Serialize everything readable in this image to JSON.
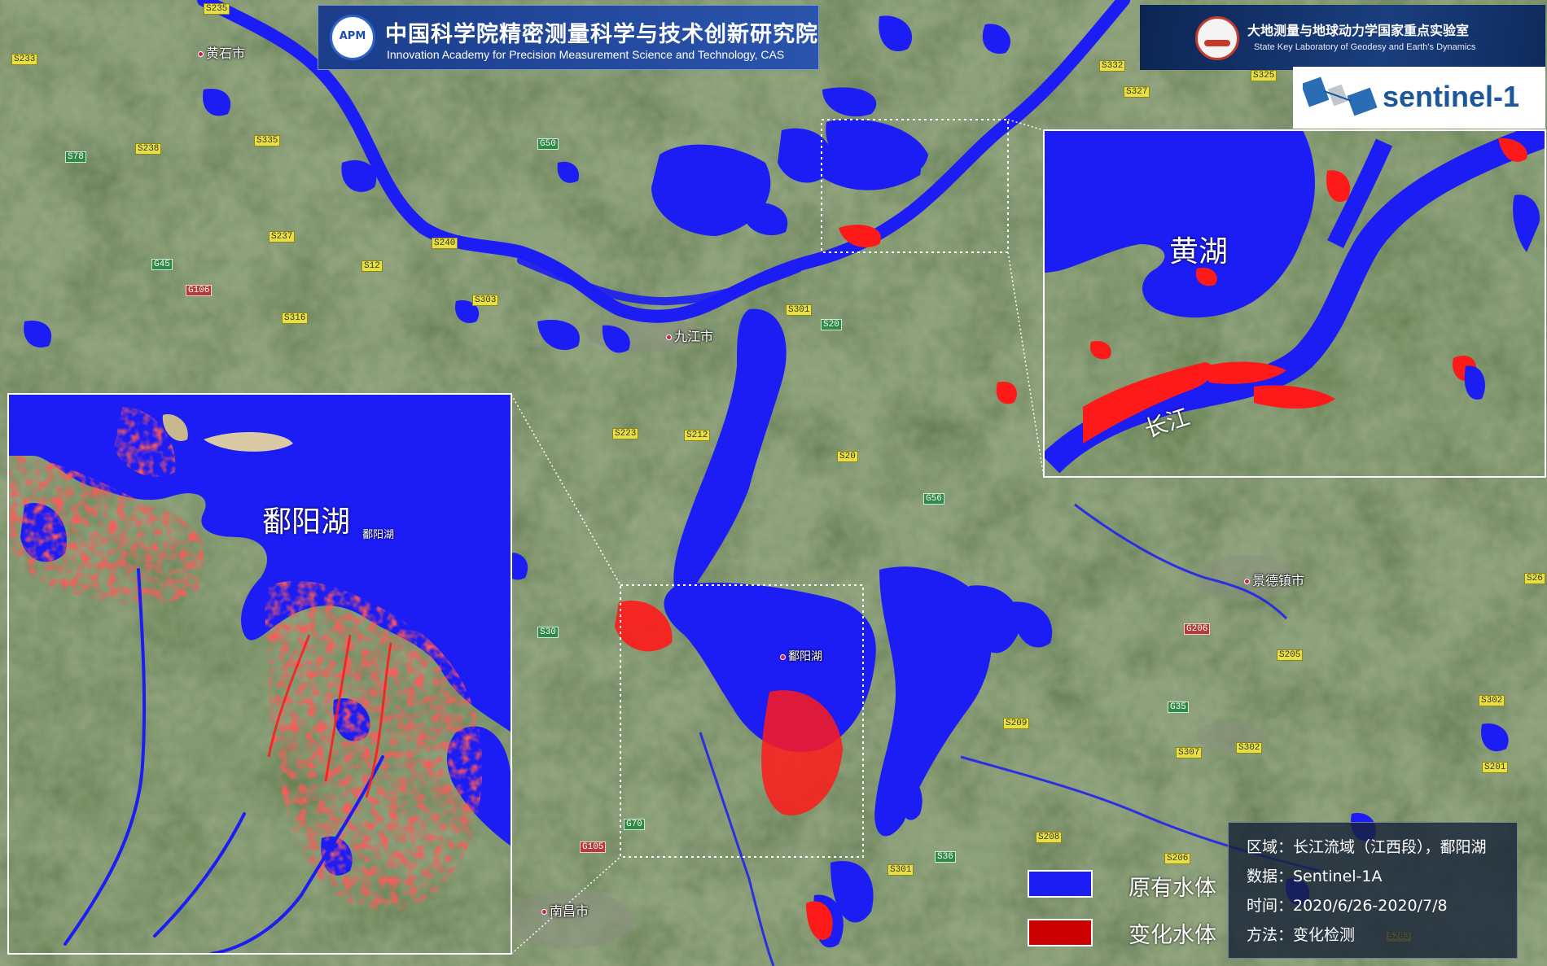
{
  "header_left": {
    "logo_text": "APM",
    "title_cn": "中国科学院精密测量科学与技术创新研究院",
    "title_en": "Innovation Academy for Precision Measurement Science and Technology, CAS"
  },
  "header_right": {
    "title_cn": "大地测量与地球动力学国家重点实验室",
    "title_en": "State Key Laboratory of Geodesy and Earth's Dynamics"
  },
  "sentinel_logo": "sentinel-1",
  "insets": {
    "poyang_label": "鄱阳湖",
    "poyang_small": "鄱阳湖",
    "huanghu_label": "黄湖",
    "changjiang_label": "长江"
  },
  "cities": [
    {
      "id": "huangshi",
      "name": "黄石市"
    },
    {
      "id": "jiujiang",
      "name": "九江市"
    },
    {
      "id": "jingdezhen",
      "name": "景德镇市"
    },
    {
      "id": "nanchang",
      "name": "南昌市"
    },
    {
      "id": "poyang-main",
      "name": "鄱阳湖"
    }
  ],
  "roads": [
    {
      "label": "S235",
      "type": "s"
    },
    {
      "label": "S233",
      "type": "s"
    },
    {
      "label": "S238",
      "type": "s"
    },
    {
      "label": "S78",
      "type": "g"
    },
    {
      "label": "S335",
      "type": "s"
    },
    {
      "label": "G50",
      "type": "g"
    },
    {
      "label": "S237",
      "type": "s"
    },
    {
      "label": "G45",
      "type": "g"
    },
    {
      "label": "G106",
      "type": "r"
    },
    {
      "label": "S240",
      "type": "s"
    },
    {
      "label": "S12",
      "type": "s"
    },
    {
      "label": "S303",
      "type": "s"
    },
    {
      "label": "S316",
      "type": "s"
    },
    {
      "label": "S332",
      "type": "s"
    },
    {
      "label": "S327",
      "type": "s"
    },
    {
      "label": "S325",
      "type": "s"
    },
    {
      "label": "S301",
      "type": "s"
    },
    {
      "label": "S20",
      "type": "g"
    },
    {
      "label": "S212",
      "type": "s"
    },
    {
      "label": "S223",
      "type": "s"
    },
    {
      "label": "S20",
      "type": "s"
    },
    {
      "label": "G56",
      "type": "g"
    },
    {
      "label": "S30",
      "type": "g"
    },
    {
      "label": "G206",
      "type": "r"
    },
    {
      "label": "S205",
      "type": "s"
    },
    {
      "label": "G35",
      "type": "g"
    },
    {
      "label": "S209",
      "type": "s"
    },
    {
      "label": "S307",
      "type": "s"
    },
    {
      "label": "S302",
      "type": "s"
    },
    {
      "label": "S302",
      "type": "s"
    },
    {
      "label": "S201",
      "type": "s"
    },
    {
      "label": "G70",
      "type": "g"
    },
    {
      "label": "G105",
      "type": "r"
    },
    {
      "label": "S208",
      "type": "s"
    },
    {
      "label": "S206",
      "type": "s"
    },
    {
      "label": "S301",
      "type": "s"
    },
    {
      "label": "S36",
      "type": "g"
    },
    {
      "label": "S203",
      "type": "s"
    },
    {
      "label": "S26",
      "type": "s"
    }
  ],
  "legend": {
    "original_label": "原有水体",
    "original_color": "#1c1cf5",
    "change_label": "变化水体",
    "change_color": "#cc0000"
  },
  "info": {
    "region": "区域：长江流域（江西段），鄱阳湖",
    "data": "数据：Sentinel-1A",
    "time": "时间：2020/6/26-2020/7/8",
    "method": "方法：变化检测"
  },
  "colors": {
    "water": "#1c1cf5",
    "change": "#ff1a1a",
    "terrain": "#405a33"
  }
}
